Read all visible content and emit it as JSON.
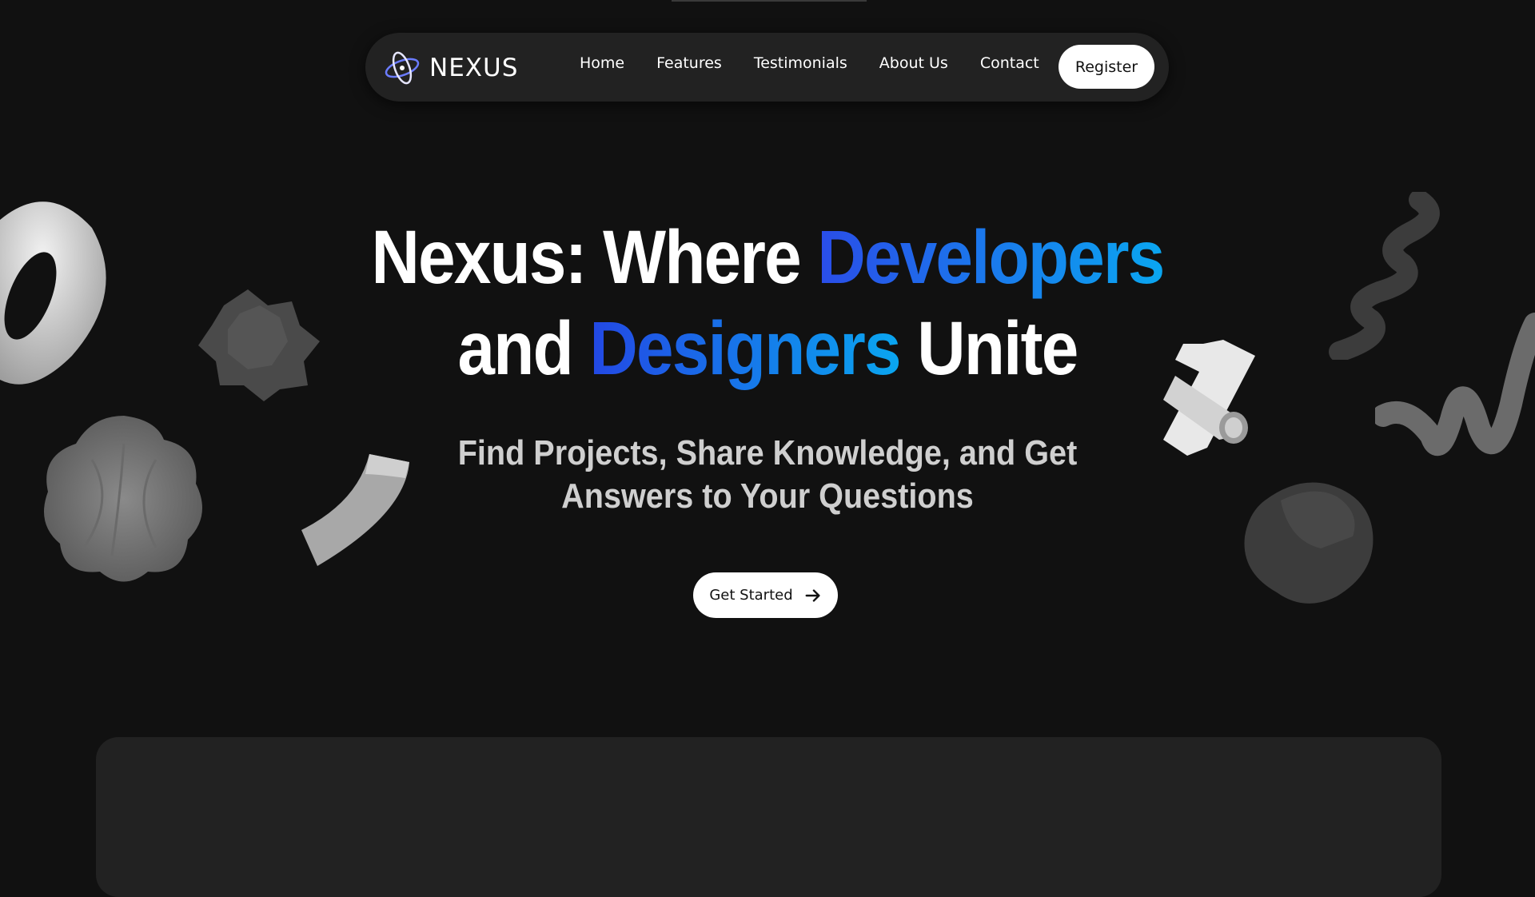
{
  "brand": {
    "name": "NEXUS",
    "logo_icon": "atom-orbit-icon"
  },
  "nav": {
    "links": [
      "Home",
      "Features",
      "Testimonials",
      "About Us",
      "Contact"
    ],
    "register_label": "Register"
  },
  "hero": {
    "title_line1_a": "Nexus: Where ",
    "title_line1_b": "Developers",
    "title_line2_a": "and ",
    "title_line2_b": "Designers",
    "title_line2_c": " Unite",
    "subtitle_line1": "Find Projects, Share Knowledge, and Get",
    "subtitle_line2": "Answers to Your Questions",
    "cta_label": "Get Started",
    "cta_icon": "arrow-right-icon"
  },
  "colors": {
    "background": "#111111",
    "nav_bg": "#222222",
    "accent_blue": "#2a4de8",
    "accent_cyan": "#0aa6f0"
  }
}
